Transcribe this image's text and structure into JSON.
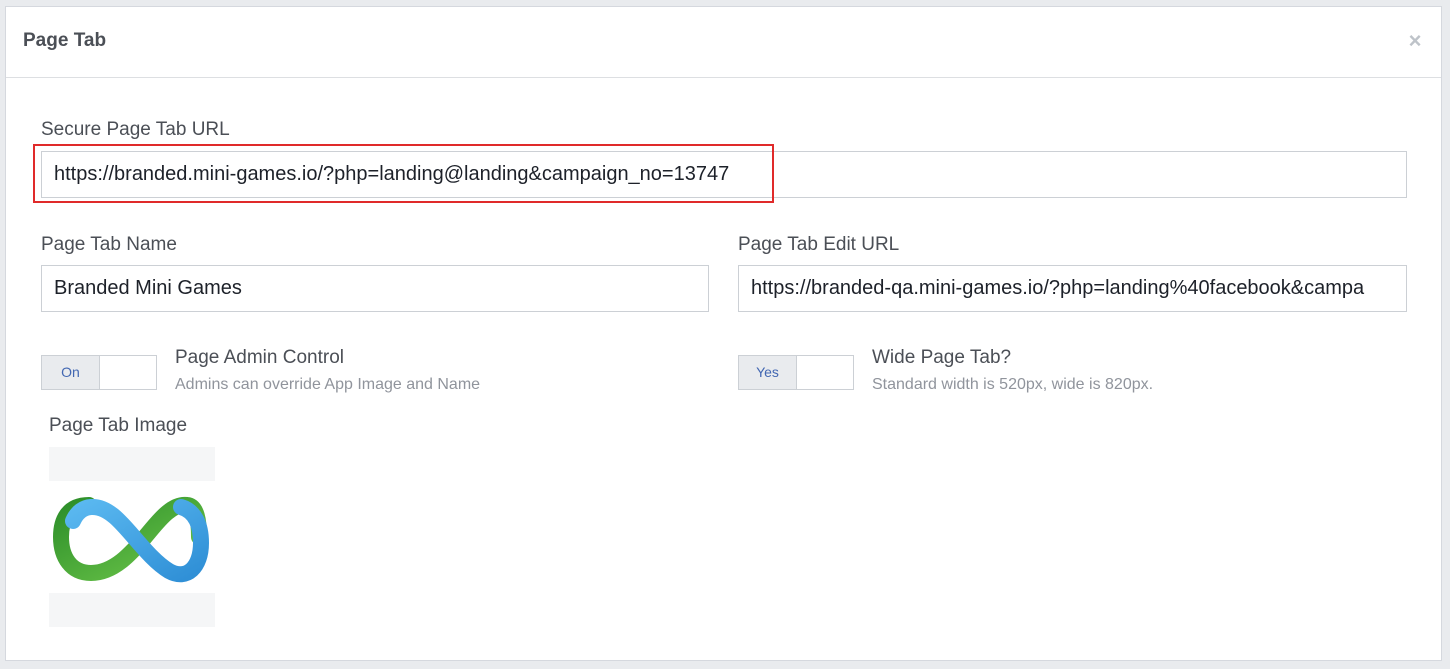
{
  "dialog": {
    "title": "Page Tab",
    "close_symbol": "×",
    "close_icon": "close-icon"
  },
  "secure_url": {
    "label": "Secure Page Tab URL",
    "value": "https://branded.mini-games.io/?php=landing@landing&campaign_no=13747",
    "highlight_color": "#e02a2a"
  },
  "page_tab_name": {
    "label": "Page Tab Name",
    "value": "Branded Mini Games"
  },
  "page_tab_edit_url": {
    "label": "Page Tab Edit URL",
    "value": "https://branded-qa.mini-games.io/?php=landing%40facebook&campa"
  },
  "admin_control": {
    "toggle_label": "On",
    "title": "Page Admin Control",
    "description": "Admins can override App Image and Name"
  },
  "wide_tab": {
    "toggle_label": "Yes",
    "title": "Wide Page Tab?",
    "description": "Standard width is 520px, wide is 820px."
  },
  "page_tab_image": {
    "label": "Page Tab Image",
    "icon": "infinity-logo-icon"
  },
  "colors": {
    "accent": "#4267b2",
    "logo_blue": "#3aa0e0",
    "logo_green": "#3fae3a"
  }
}
